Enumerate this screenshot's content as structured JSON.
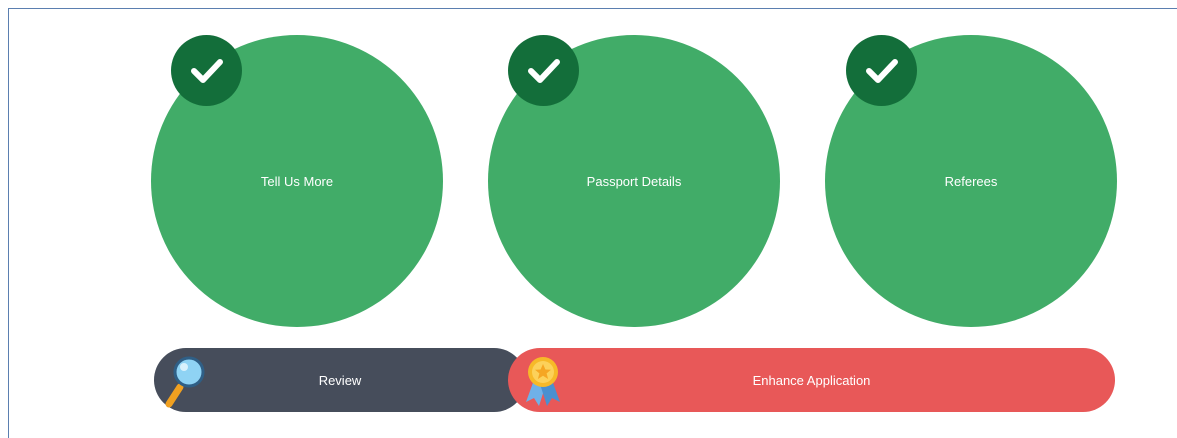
{
  "steps": [
    {
      "label": "Tell Us More",
      "status": "complete",
      "icon": "check-icon"
    },
    {
      "label": "Passport Details",
      "status": "complete",
      "icon": "check-icon"
    },
    {
      "label": "Referees",
      "status": "complete",
      "icon": "check-icon"
    }
  ],
  "actions": {
    "review": {
      "label": "Review",
      "icon": "magnifier-icon"
    },
    "enhance": {
      "label": "Enhance Application",
      "icon": "award-ribbon-icon"
    }
  },
  "colors": {
    "step_fill": "#41ac68",
    "check_badge": "#136e3a",
    "review_bg": "#464d5b",
    "enhance_bg": "#e85858",
    "frame_border": "#5b7fb0"
  }
}
